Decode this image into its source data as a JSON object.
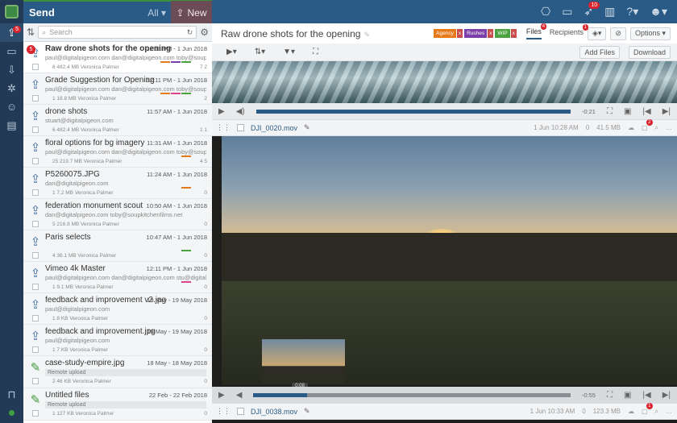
{
  "sidebar": {
    "badge": "5"
  },
  "send": {
    "title": "Send",
    "filter": "All ▾",
    "new_label": "New"
  },
  "search": {
    "placeholder": "Search"
  },
  "items": [
    {
      "title": "Raw drone shots for the opening",
      "date": "12:11 PM - 1 Jun 2018",
      "to": "paul@digitalpigeon.com  dan@digitalpigeon.com  toby@soupkitchen",
      "meta": "6   482.4 MB   Veronica Palmer",
      "cnt": "7  2",
      "badge": "5"
    },
    {
      "title": "Grade Suggestion for Opening",
      "date": "12:11 PM - 1 Jun 2018",
      "to": "paul@digitalpigeon.com  dan@digitalpigeon.com  toby@soupkitchen",
      "meta": "1   18.8 MB   Veronica Palmer",
      "cnt": "2"
    },
    {
      "title": "drone shots",
      "date": "11:57 AM - 1 Jun 2018",
      "to": "stuart@digitalpigeon.com",
      "meta": "6   482.4 MB   Veronica Palmer",
      "cnt": "1  1"
    },
    {
      "title": "floral options for bg imagery",
      "date": "11:31 AM - 1 Jun 2018",
      "to": "paul@digitalpigeon.com  dan@digitalpigeon.com  toby@soupkitchen",
      "meta": "25   219.7 MB   Veronica Palmer",
      "cnt": "4  5"
    },
    {
      "title": "P5260075.JPG",
      "date": "11:24 AM - 1 Jun 2018",
      "to": "dan@digitalpigeon.com",
      "meta": "1   7.2 MB   Veronica Palmer",
      "cnt": "0"
    },
    {
      "title": "federation monument scout",
      "date": "10:50 AM - 1 Jun 2018",
      "to": "dan@digitalpigeon.com  toby@soupkitchenfilms.net",
      "meta": "5   216.8 MB   Veronica Palmer",
      "cnt": "0"
    },
    {
      "title": "Paris selects",
      "date": "10:47 AM - 1 Jun 2018",
      "to": "",
      "meta": "4   36.1 MB   Veronica Palmer",
      "cnt": "0"
    },
    {
      "title": "Vimeo 4k Master",
      "date": "12:11 PM - 1 Jun 2018",
      "to": "paul@digitalpigeon.com  dan@digitalpigeon.com  stu@digitalpigeon.com",
      "meta": "1   9.1 MB   Veronica Palmer",
      "cnt": "0"
    },
    {
      "title": "feedback and improvement v2.jpg",
      "date": "19 May - 19 May 2018",
      "to": "paul@digitalpigeon.com",
      "meta": "1   8 KB   Veronica Palmer",
      "cnt": "0"
    },
    {
      "title": "feedback and improvement.jpg",
      "date": "19 May - 19 May 2018",
      "to": "paul@digitalpigeon.com",
      "meta": "1   7 KB   Veronica Palmer",
      "cnt": "0"
    },
    {
      "title": "case-study-empire.jpg",
      "date": "18 May - 18 May 2018",
      "remote": "Remote upload",
      "meta": "2   46 KB   Veronica Palmer",
      "cnt": "0"
    },
    {
      "title": "Untitled files",
      "date": "22 Feb - 22 Feb 2018",
      "remote": "Remote upload",
      "meta": "1   127 KB   Veronica Palmer",
      "cnt": "0"
    }
  ],
  "topbar": {
    "badge_rocket": "10"
  },
  "header": {
    "title": "Raw drone shots for the opening",
    "tags": [
      {
        "label": "Agency",
        "color": "#e67a1b"
      },
      {
        "label": "Rushes",
        "color": "#7a3fa8"
      },
      {
        "label": "WIP",
        "color": "#4aa33f"
      }
    ],
    "tab_files": "Files",
    "files_badge": "4",
    "tab_recipients": "Recipients",
    "recipients_badge": "1",
    "options": "Options ▾"
  },
  "toolbar": {
    "add_files": "Add Files",
    "download": "Download"
  },
  "player1": {
    "time": "-0:21",
    "progress": 1.0
  },
  "file1": {
    "name": "DJI_0020.mov",
    "date": "1 Jun 10:28 AM",
    "versions": "0",
    "size": "41.5 MB",
    "comments": "2"
  },
  "player2": {
    "time": "-0:55",
    "progress": 0.17,
    "tooltip": "0:08"
  },
  "file2": {
    "name": "DJI_0038.mov",
    "date": "1 Jun 10:33 AM",
    "versions": "0",
    "size": "123.3 MB",
    "comments": "1"
  }
}
